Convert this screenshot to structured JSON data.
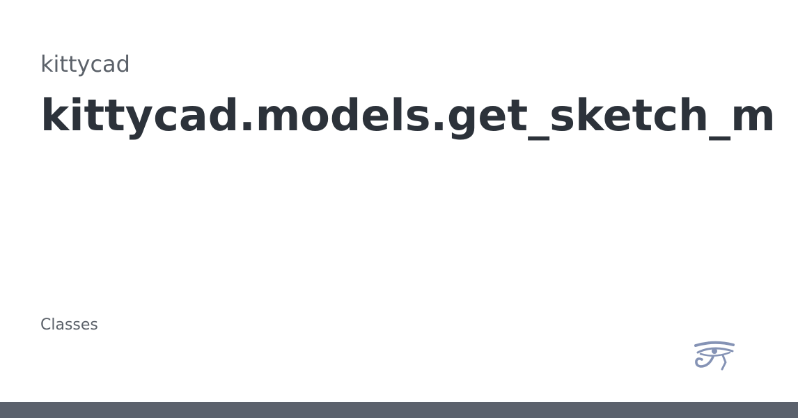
{
  "card": {
    "project_name": "kittycad",
    "page_title": "kittycad.models.get_sketch_m",
    "category_label": "Classes"
  },
  "logo": {
    "icon": "eye-of-horus-icon",
    "color": "#8593b5"
  },
  "colors": {
    "title_text": "#2c323a",
    "muted_text": "#5b6169",
    "footer_bar": "#5b616c",
    "background": "#ffffff"
  }
}
